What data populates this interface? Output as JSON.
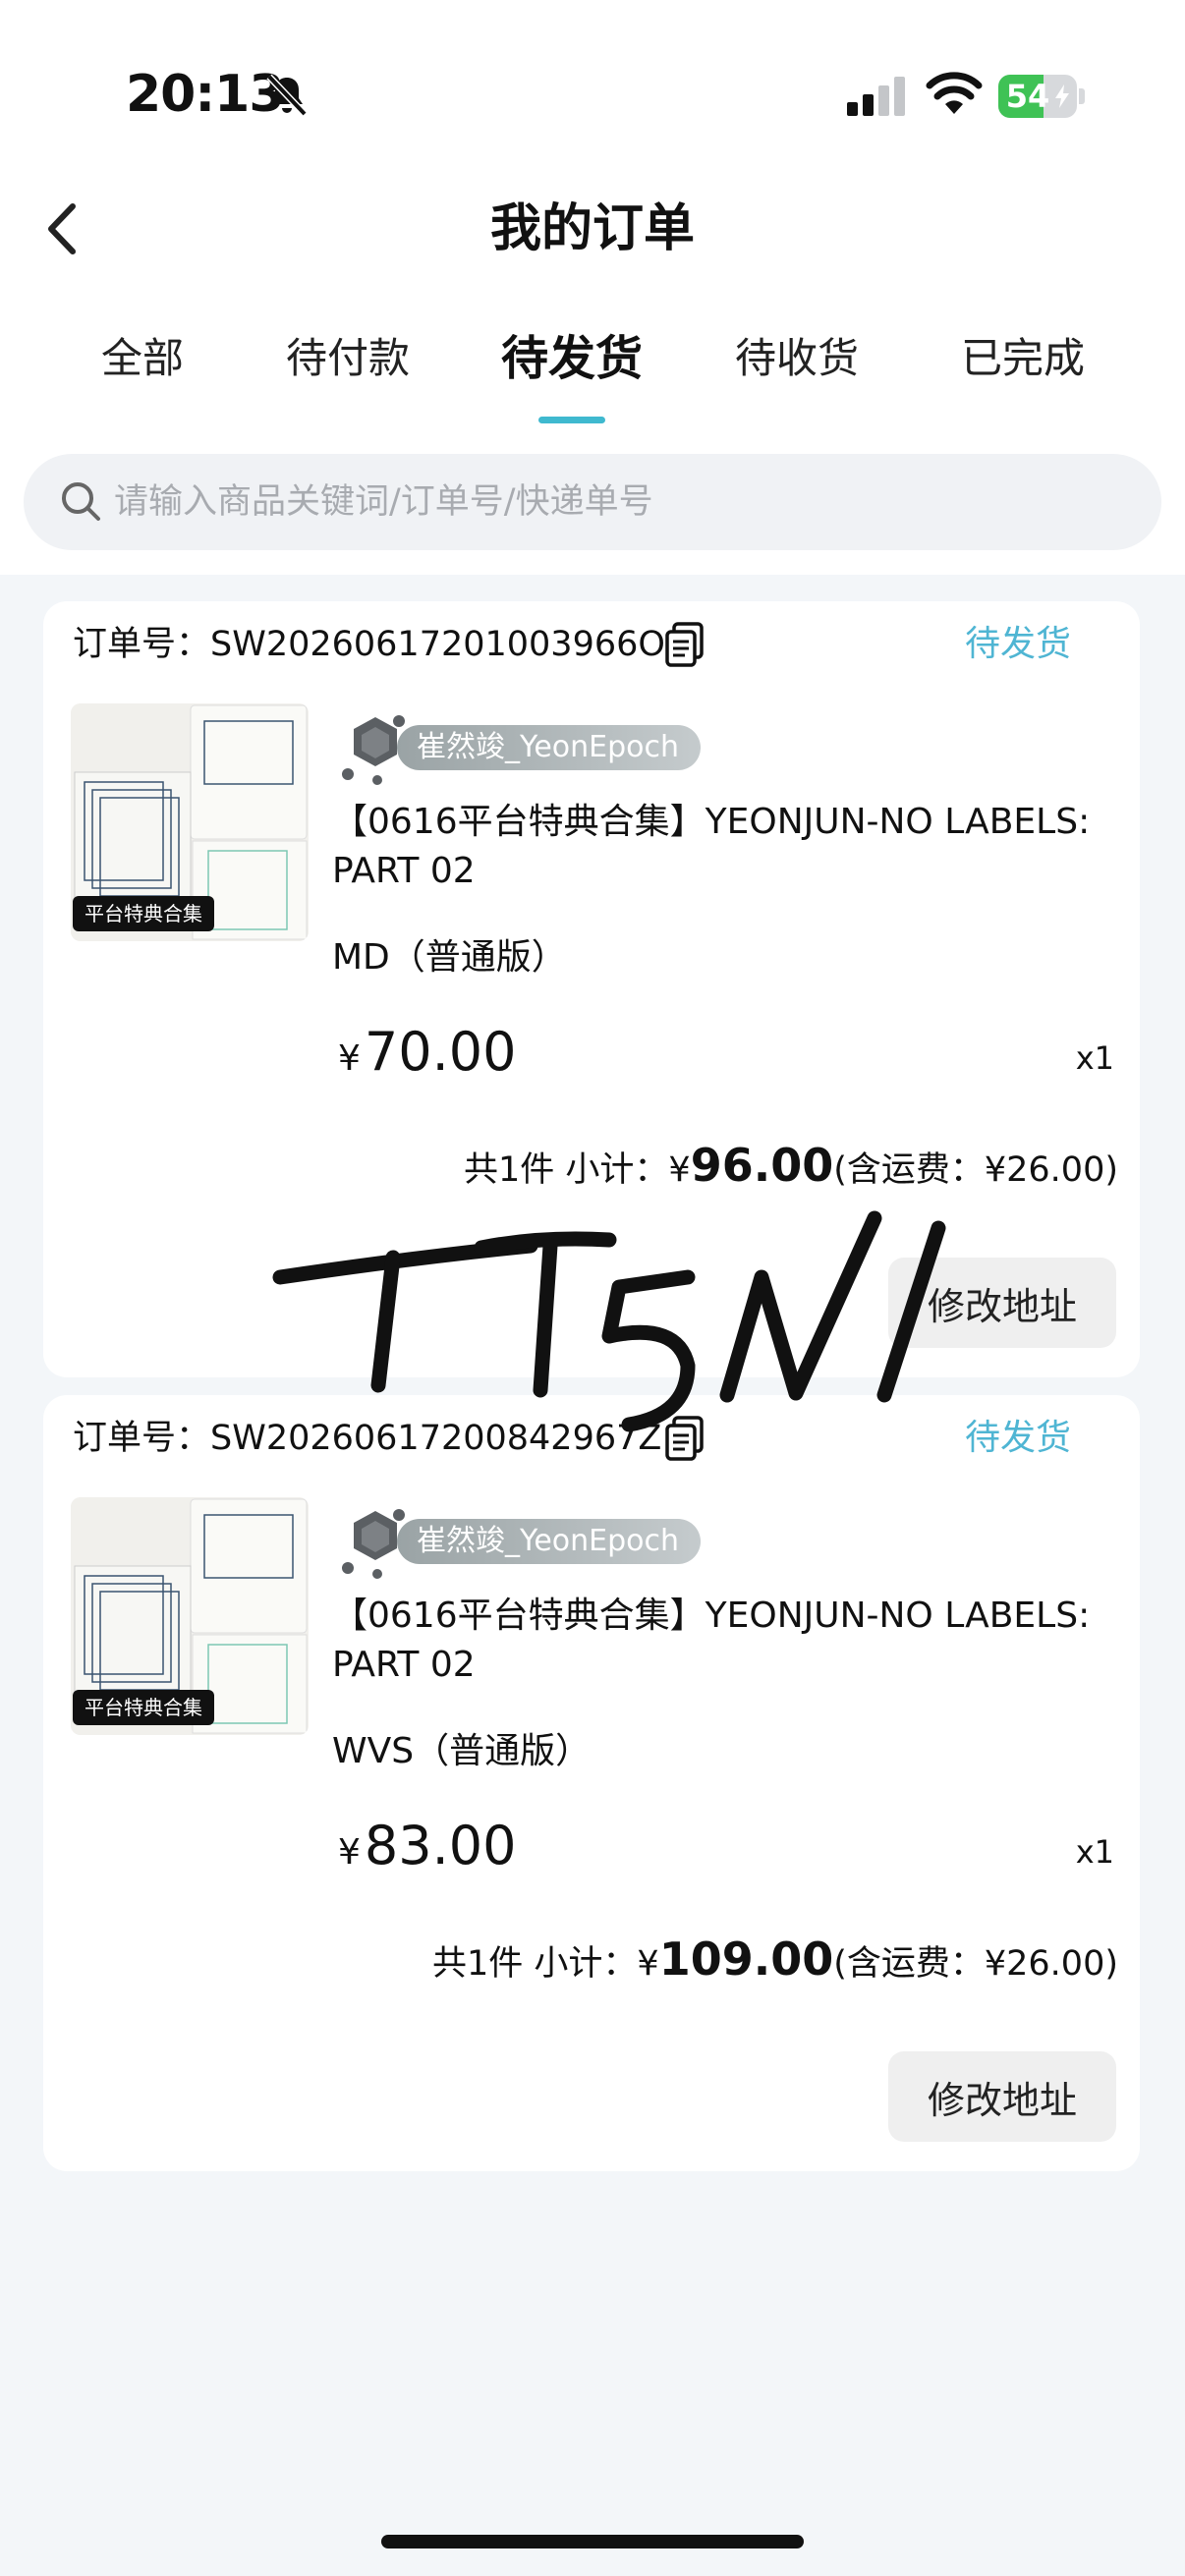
{
  "status_bar": {
    "time": "20:13",
    "battery": "54"
  },
  "header": {
    "title": "我的订单"
  },
  "tabs": [
    {
      "label": "全部"
    },
    {
      "label": "待付款"
    },
    {
      "label": "待发货",
      "active": true
    },
    {
      "label": "待收货"
    },
    {
      "label": "已完成"
    }
  ],
  "search": {
    "placeholder": "请输入商品关键词/订单号/快递单号"
  },
  "orders": [
    {
      "order_label": "订单号：SW20260617201003966O",
      "status": "待发货",
      "thumb_badge": "平台特典合集",
      "shop_name": "崔然竣_YeonEpoch",
      "product_name": "【0616平台特典合集】YEONJUN-NO LABELS: PART 02",
      "variant": "MD（普通版）",
      "price_symbol": "¥",
      "price": "70.00",
      "quantity": "x1",
      "count_text": "共1件  小计：¥",
      "subtotal": "96.00",
      "shipping_text": "(含运费：¥26.00)",
      "button": "修改地址"
    },
    {
      "order_label": "订单号：SW20260617200842967Z",
      "status": "待发货",
      "thumb_badge": "平台特典合集",
      "shop_name": "崔然竣_YeonEpoch",
      "product_name": "【0616平台特典合集】YEONJUN-NO LABELS: PART 02",
      "variant": "WVS（普通版）",
      "price_symbol": "¥",
      "price": "83.00",
      "quantity": "x1",
      "count_text": "共1件  小计：¥",
      "subtotal": "109.00",
      "shipping_text": "(含运费：¥26.00)",
      "button": "修改地址"
    }
  ],
  "overlay": {
    "handwriting": "TT5NI"
  },
  "colors": {
    "accent": "#4fb5d3",
    "tab_indicator": "#3fb9cf",
    "page_bg": "#f3f6f9",
    "battery": "#3fc255"
  }
}
